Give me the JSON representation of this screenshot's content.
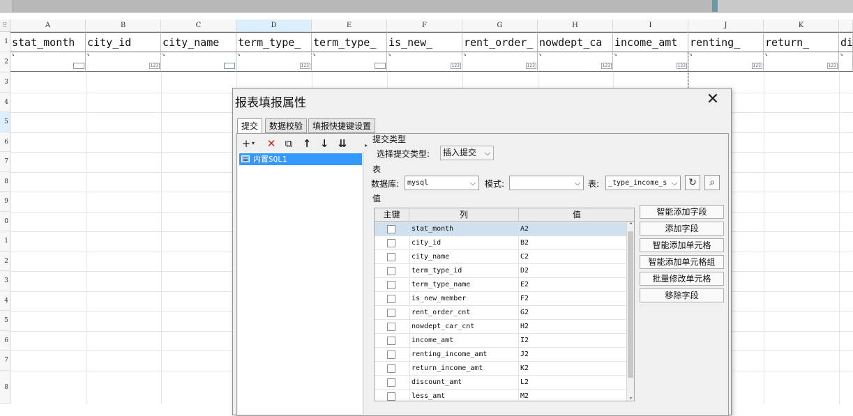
{
  "sheet": {
    "columns": [
      "A",
      "B",
      "C",
      "D",
      "E",
      "F",
      "G",
      "H",
      "I",
      "J",
      "K"
    ],
    "row_numbers": [
      "1",
      "2",
      "3",
      "4",
      "5",
      "6",
      "7",
      "8",
      "9",
      "0",
      "1",
      "2",
      "3",
      "4",
      "5",
      "6",
      "7",
      "8"
    ],
    "header_cells": [
      "stat_month",
      "city_id",
      "city_name",
      "term_type_",
      "term_type_",
      "is_new_",
      "rent_order_",
      "nowdept_ca",
      "income_amt",
      "renting_",
      "return_",
      "di"
    ],
    "data_cell_arrow": "↘",
    "tag_label": "123",
    "corner_label": "⠿"
  },
  "dialog": {
    "title": "报表填报属性",
    "close_glyph": "✕",
    "tabs": [
      "提交",
      "数据校验",
      "填报快捷键设置"
    ],
    "toolbar": {
      "add": "+",
      "add_caret": "▾",
      "delete": "✕",
      "copy": "⧉",
      "up": "↑",
      "down": "↓",
      "bottom": "⇊"
    },
    "list_item": "内置SQL1",
    "splitter_glyph": "▸",
    "submit_type": {
      "group_label": "提交类型",
      "select_label": "选择提交类型:",
      "value": "插入提交",
      "caret": "⌵"
    },
    "table_section": {
      "group_label": "表",
      "db_label": "数据库:",
      "db_value": "mysql",
      "schema_label": "模式:",
      "schema_value": "",
      "table_label": "表:",
      "table_value": "_type_income_s",
      "caret": "⌵",
      "refresh_glyph": "↻",
      "preview_glyph": "⌕"
    },
    "values_section": {
      "group_label": "值",
      "headers": [
        "主键",
        "列",
        "值"
      ],
      "rows": [
        {
          "col": "stat_month",
          "val": "A2"
        },
        {
          "col": "city_id",
          "val": "B2"
        },
        {
          "col": "city_name",
          "val": "C2"
        },
        {
          "col": "term_type_id",
          "val": "D2"
        },
        {
          "col": "term_type_name",
          "val": "E2"
        },
        {
          "col": "is_new_member",
          "val": "F2"
        },
        {
          "col": "rent_order_cnt",
          "val": "G2"
        },
        {
          "col": "nowdept_car_cnt",
          "val": "H2"
        },
        {
          "col": "income_amt",
          "val": "I2"
        },
        {
          "col": "renting_income_amt",
          "val": "J2"
        },
        {
          "col": "return_income_amt",
          "val": "K2"
        },
        {
          "col": "discount_amt",
          "val": "L2"
        },
        {
          "col": "less_amt",
          "val": "M2"
        }
      ],
      "scroll_up": "⌃",
      "scroll_down": "⌄"
    },
    "side_buttons": [
      "智能添加字段",
      "添加字段",
      "智能添加单元格",
      "智能添加单元格组",
      "批量修改单元格",
      "移除字段"
    ]
  }
}
